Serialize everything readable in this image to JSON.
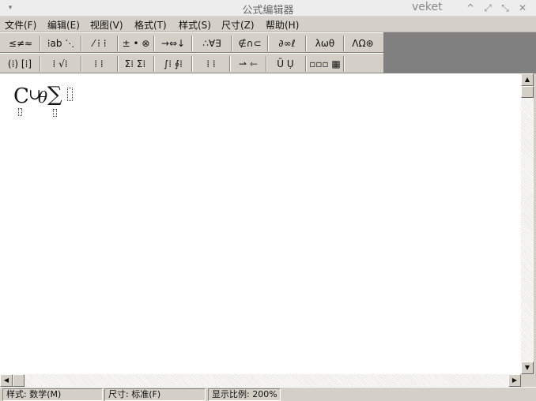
{
  "window": {
    "title": "公式编辑器",
    "user": "veket",
    "sysmenu_icon": "▾",
    "min_icon": "^",
    "max_icon": "⤢",
    "close_icon": "✕"
  },
  "menu": [
    {
      "label": "文件(F)"
    },
    {
      "label": "编辑(E)"
    },
    {
      "label": "视图(V)"
    },
    {
      "label": "格式(T)"
    },
    {
      "label": "样式(S)"
    },
    {
      "label": "尺寸(Z)"
    },
    {
      "label": "帮助(H)"
    }
  ],
  "toolbar_row1": [
    {
      "symbols": "≤≠≈",
      "name": "relations-palette"
    },
    {
      "symbols": "⁞ab ⋱",
      "name": "spaces-ellipses-palette"
    },
    {
      "symbols": "⁄ ⁞ ⁞",
      "name": "embellishments-palette"
    },
    {
      "symbols": "± • ⊗",
      "name": "operators-palette"
    },
    {
      "symbols": "→⇔↓",
      "name": "arrows-palette"
    },
    {
      "symbols": "∴∀∃",
      "name": "logic-palette"
    },
    {
      "symbols": "∉∩⊂",
      "name": "set-theory-palette"
    },
    {
      "symbols": "∂∞ℓ",
      "name": "misc-symbols-palette"
    },
    {
      "symbols": "λωθ",
      "name": "greek-lower-palette"
    },
    {
      "symbols": "ΛΩ⊛",
      "name": "greek-upper-palette"
    }
  ],
  "toolbar_row2": [
    {
      "symbols": "(⁞) [⁞]",
      "name": "fences-palette"
    },
    {
      "symbols": "⁞ √⁞",
      "name": "fractions-radicals-palette"
    },
    {
      "symbols": "⁞ ⁞",
      "name": "scripts-palette"
    },
    {
      "symbols": "Σ⁞ Σ⁞",
      "name": "summations-palette"
    },
    {
      "symbols": "∫⁞ ∮⁞",
      "name": "integrals-palette"
    },
    {
      "symbols": "⁞ ⁞",
      "name": "underbars-overbars-palette"
    },
    {
      "symbols": "⇀ ⇽",
      "name": "labeled-arrows-palette"
    },
    {
      "symbols": "Ū Ụ",
      "name": "products-palette"
    },
    {
      "symbols": "▫▫▫ ▦",
      "name": "matrices-palette"
    }
  ],
  "formula": {
    "big_c": "C",
    "union": "∪",
    "theta": "θ",
    "sigma": "∑"
  },
  "status": {
    "style": "样式: 数学(M)",
    "size": "尺寸: 标准(F)",
    "zoom": "显示比例: 200%"
  },
  "scroll_icons": {
    "up": "▲",
    "down": "▼",
    "left": "◀",
    "right": "▶"
  }
}
